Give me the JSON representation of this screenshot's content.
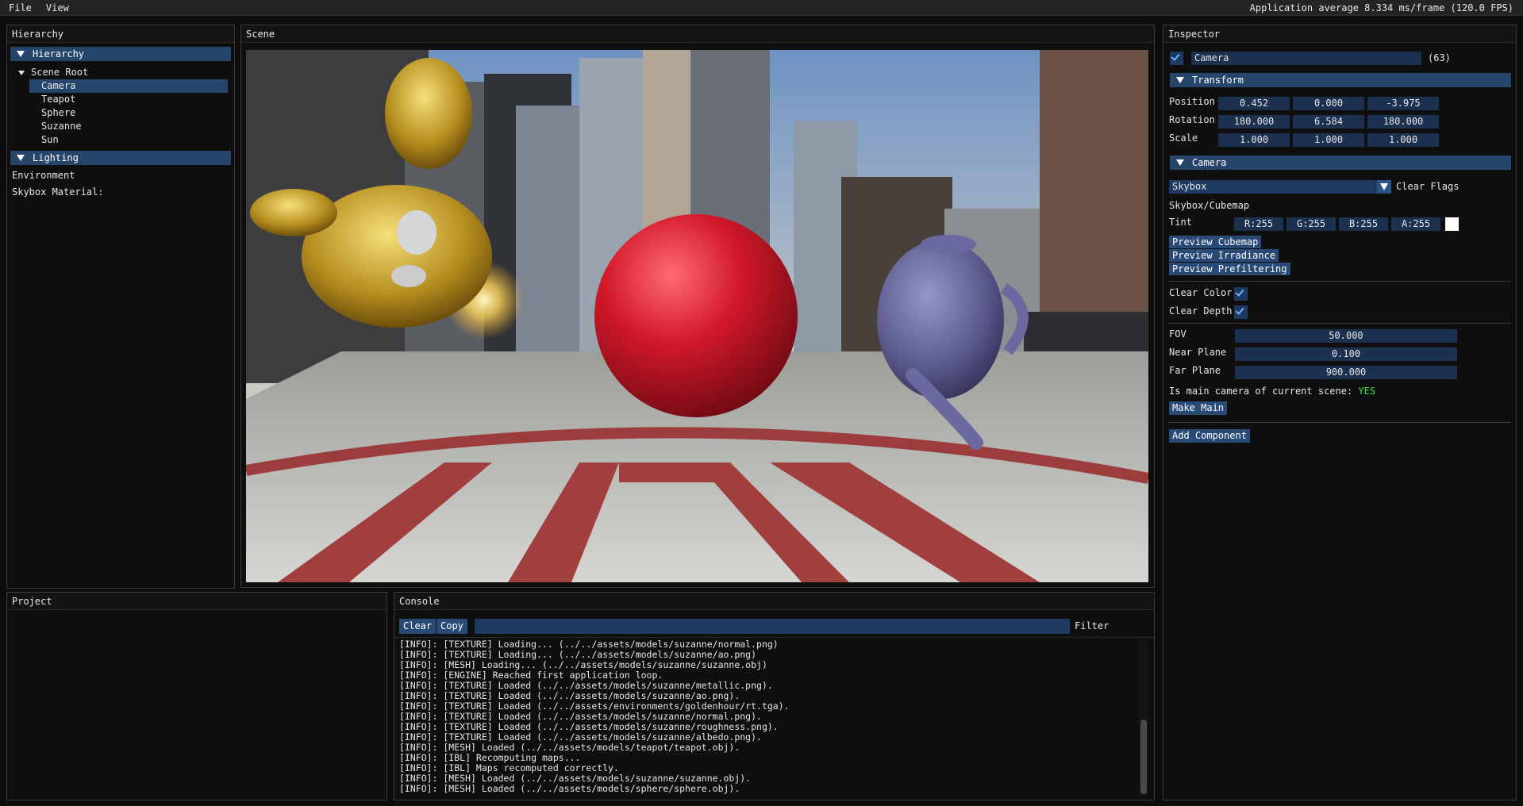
{
  "menu": {
    "file": "File",
    "view": "View",
    "fps": "Application average 8.334 ms/frame (120.0 FPS)"
  },
  "hierarchy": {
    "title": "Hierarchy",
    "section_label": "Hierarchy",
    "root_label": "Scene Root",
    "items": [
      "Camera",
      "Teapot",
      "Sphere",
      "Suzanne",
      "Sun"
    ],
    "lighting_label": "Lighting",
    "environment_label": "Environment",
    "skybox_material_label": "Skybox Material:"
  },
  "scene": {
    "title": "Scene"
  },
  "inspector": {
    "title": "Inspector",
    "object_name": "Camera",
    "object_id": "(63)",
    "transform": {
      "label": "Transform",
      "position_label": "Position",
      "position": [
        "0.452",
        "0.000",
        "-3.975"
      ],
      "rotation_label": "Rotation",
      "rotation": [
        "180.000",
        "6.584",
        "180.000"
      ],
      "scale_label": "Scale",
      "scale": [
        "1.000",
        "1.000",
        "1.000"
      ]
    },
    "camera": {
      "label": "Camera",
      "clear_flags_value": "Skybox",
      "clear_flags_label": "Clear Flags",
      "skybox_cubemap_label": "Skybox/Cubemap",
      "tint_label": "Tint",
      "tint": {
        "r": "R:255",
        "g": "G:255",
        "b": "B:255",
        "a": "A:255"
      },
      "tint_color": "#ffffff",
      "preview_cubemap": "Preview Cubemap",
      "preview_irradiance": "Preview Irradiance",
      "preview_prefiltering": "Preview Prefiltering",
      "clear_color_label": "Clear Color",
      "clear_depth_label": "Clear Depth",
      "fov_label": "FOV",
      "fov": "50.000",
      "near_label": "Near Plane",
      "near": "0.100",
      "far_label": "Far Plane",
      "far": "900.000",
      "main_camera_label": "Is main camera of current scene:",
      "main_camera_value": "YES",
      "make_main": "Make Main"
    },
    "add_component": "Add Component"
  },
  "project": {
    "title": "Project"
  },
  "console": {
    "title": "Console",
    "clear": "Clear",
    "copy": "Copy",
    "filter_label": "Filter",
    "filter_value": "",
    "lines": [
      "[INFO]: [TEXTURE] Loading... (../../assets/models/suzanne/normal.png)",
      "[INFO]: [TEXTURE] Loading... (../../assets/models/suzanne/ao.png)",
      "[INFO]: [MESH] Loading... (../../assets/models/suzanne/suzanne.obj)",
      "[INFO]: [ENGINE] Reached first application loop.",
      "[INFO]: [TEXTURE] Loaded (../../assets/models/suzanne/metallic.png).",
      "[INFO]: [TEXTURE] Loaded (../../assets/models/suzanne/ao.png).",
      "[INFO]: [TEXTURE] Loaded (../../assets/environments/goldenhour/rt.tga).",
      "[INFO]: [TEXTURE] Loaded (../../assets/models/suzanne/normal.png).",
      "[INFO]: [TEXTURE] Loaded (../../assets/models/suzanne/roughness.png).",
      "[INFO]: [TEXTURE] Loaded (../../assets/models/suzanne/albedo.png).",
      "[INFO]: [MESH] Loaded (../../assets/models/teapot/teapot.obj).",
      "[INFO]: [IBL] Recomputing maps...",
      "[INFO]: [IBL] Maps recomputed correctly.",
      "[INFO]: [MESH] Loaded (../../assets/models/suzanne/suzanne.obj).",
      "[INFO]: [MESH] Loaded (../../assets/models/sphere/sphere.obj)."
    ]
  },
  "colors": {
    "accent": "#26456a",
    "button": "#294a76",
    "field": "#1c3050",
    "yes": "#3ddc3d"
  }
}
